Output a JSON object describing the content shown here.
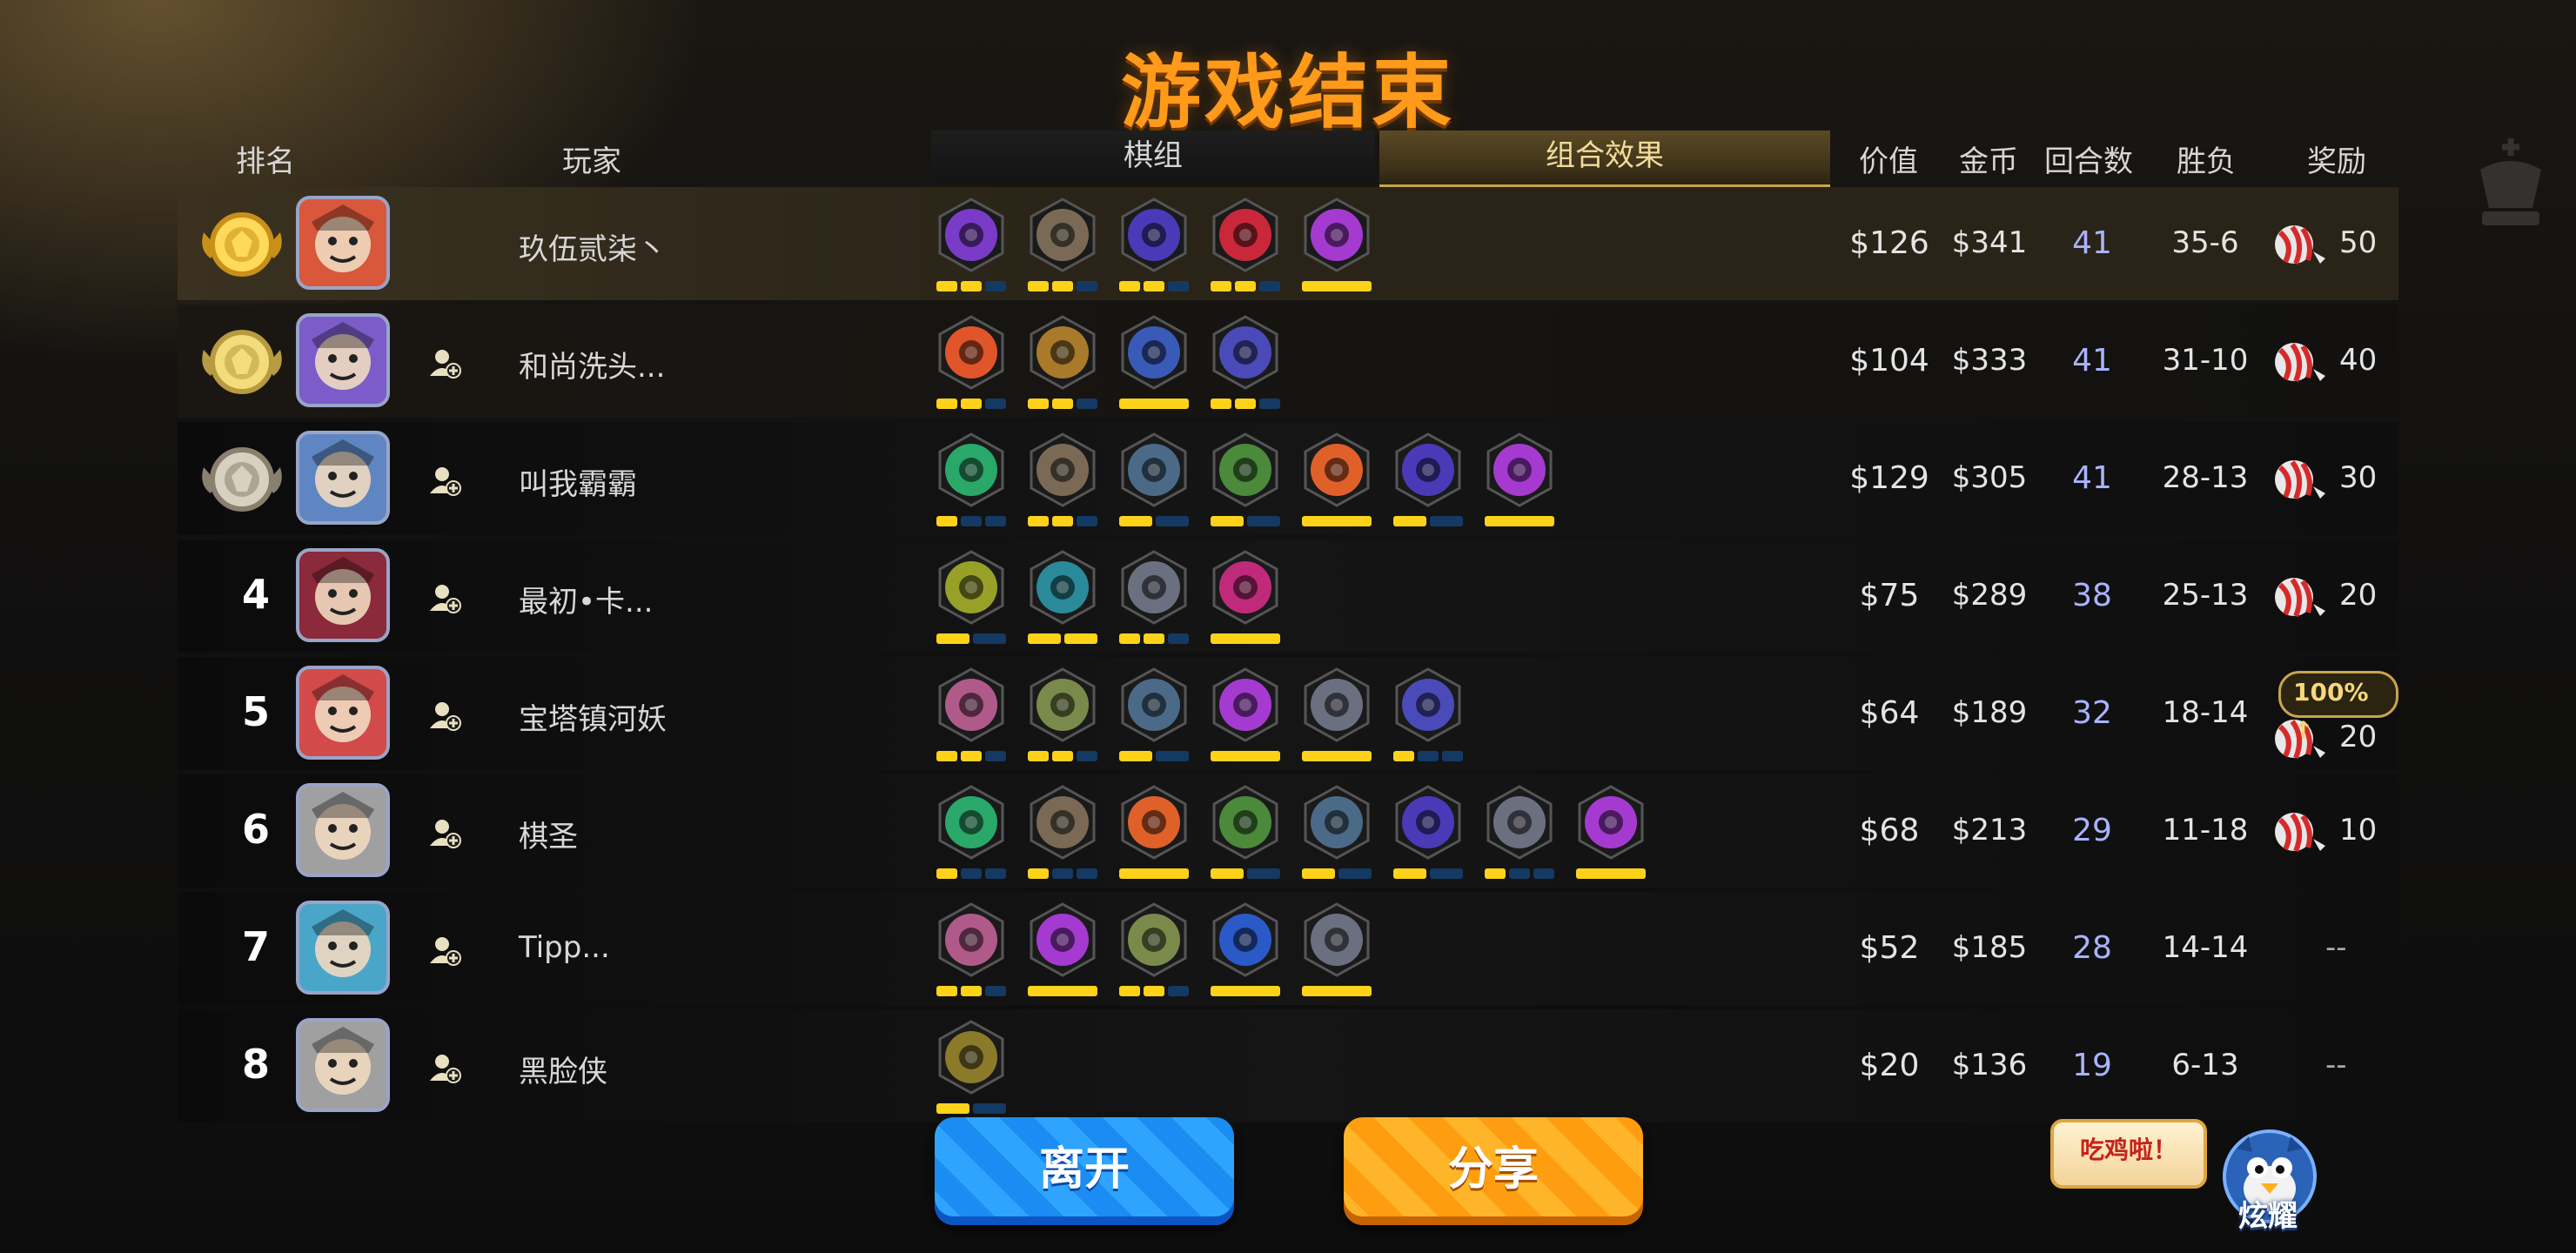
{
  "title": "游戏结束",
  "headers": {
    "rank": "排名",
    "player": "玩家",
    "lineup": "棋组",
    "synergy": "组合效果",
    "value": "价值",
    "gold": "金币",
    "rounds": "回合数",
    "winloss": "胜负",
    "reward": "奖励"
  },
  "colors": {
    "title": "#ff9a1a",
    "star_on": "#ffd21a",
    "star_off": "#143a63",
    "rounds": "#a9b3ff"
  },
  "rows": [
    {
      "rank": "",
      "medal": "gold-medal-icon",
      "name": "玖伍贰柒丶",
      "add_friend": false,
      "value": "$126",
      "gold": "$341",
      "rounds": "41",
      "winloss": "35-6",
      "reward": "50",
      "avatar_color": "#d9573a"
    },
    {
      "rank": "",
      "medal": "silver-gold-medal-icon",
      "name": "和尚洗头...",
      "add_friend": true,
      "value": "$104",
      "gold": "$333",
      "rounds": "41",
      "winloss": "31-10",
      "reward": "40",
      "avatar_color": "#7b5cc9"
    },
    {
      "rank": "",
      "medal": "bronze-medal-icon",
      "name": "叫我霸霸",
      "add_friend": true,
      "value": "$129",
      "gold": "$305",
      "rounds": "41",
      "winloss": "28-13",
      "reward": "30",
      "avatar_color": "#5f86c2"
    },
    {
      "rank": "4",
      "medal": "",
      "name": "最初•卡...",
      "add_friend": true,
      "value": "$75",
      "gold": "$289",
      "rounds": "38",
      "winloss": "25-13",
      "reward": "20",
      "avatar_color": "#8a2a3a"
    },
    {
      "rank": "5",
      "medal": "",
      "name": "宝塔镇河妖",
      "add_friend": true,
      "value": "$64",
      "gold": "$189",
      "rounds": "32",
      "winloss": "18-14",
      "reward": "20",
      "bonus": "100%",
      "avatar_color": "#d24a4a"
    },
    {
      "rank": "6",
      "medal": "",
      "name": "棋圣",
      "add_friend": true,
      "value": "$68",
      "gold": "$213",
      "rounds": "29",
      "winloss": "11-18",
      "reward": "10",
      "avatar_color": "#a0a0a0"
    },
    {
      "rank": "7",
      "medal": "",
      "name": "Tipp...",
      "add_friend": true,
      "value": "$52",
      "gold": "$185",
      "rounds": "28",
      "winloss": "14-14",
      "reward": "--",
      "avatar_color": "#4aa6c9"
    },
    {
      "rank": "8",
      "medal": "",
      "name": "黑脸侠",
      "add_friend": true,
      "value": "$20",
      "gold": "$136",
      "rounds": "19",
      "winloss": "6-13",
      "reward": "--",
      "avatar_color": "#a0a0a0"
    }
  ],
  "lineups": [
    [
      {
        "icon": "purple-demon-icon",
        "c": "#7a3cc8",
        "s": [
          1,
          1,
          0
        ]
      },
      {
        "icon": "axe-warrior-icon",
        "c": "#7a6a55",
        "s": [
          1,
          1,
          0
        ]
      },
      {
        "icon": "fish-skeleton-icon",
        "c": "#4a3ab8",
        "s": [
          1,
          1,
          0
        ]
      },
      {
        "icon": "red-arch-icon",
        "c": "#c8283a",
        "s": [
          1,
          1,
          0
        ]
      },
      {
        "icon": "purple-skull-icon",
        "c": "#a53ad0",
        "s": [
          1
        ]
      }
    ],
    [
      {
        "icon": "orange-beast-icon",
        "c": "#e0552a",
        "s": [
          1,
          1,
          0
        ]
      },
      {
        "icon": "gear-icon",
        "c": "#a87a2a",
        "s": [
          1,
          1,
          0
        ]
      },
      {
        "icon": "wizard-hat-icon",
        "c": "#3a5ab8",
        "s": [
          1
        ]
      },
      {
        "icon": "spellbook-icon",
        "c": "#4a4ab8",
        "s": [
          1,
          1,
          0
        ]
      }
    ],
    [
      {
        "icon": "paw-icon",
        "c": "#2aa86a",
        "s": [
          1,
          0,
          0
        ]
      },
      {
        "icon": "axe-warrior-icon",
        "c": "#7a6a55",
        "s": [
          1,
          1,
          0
        ]
      },
      {
        "icon": "swirl-icon",
        "c": "#4a6a88",
        "s": [
          1,
          0
        ]
      },
      {
        "icon": "bow-icon",
        "c": "#4a8a3a",
        "s": [
          1,
          0
        ]
      },
      {
        "icon": "horned-helmet-icon",
        "c": "#e0602a",
        "s": [
          1
        ]
      },
      {
        "icon": "fish-skeleton-icon",
        "c": "#4a3ab8",
        "s": [
          1,
          0
        ]
      },
      {
        "icon": "purple-skull-icon",
        "c": "#a53ad0",
        "s": [
          1
        ]
      }
    ],
    [
      {
        "icon": "ore-icon",
        "c": "#98a028",
        "s": [
          1,
          0
        ]
      },
      {
        "icon": "question-icon",
        "c": "#2a8a9a",
        "s": [
          1,
          1
        ]
      },
      {
        "icon": "knight-helm-icon",
        "c": "#6a7080",
        "s": [
          1,
          1,
          0
        ]
      },
      {
        "icon": "pink-blade-icon",
        "c": "#c02a7a",
        "s": [
          1
        ]
      }
    ],
    [
      {
        "icon": "chess-knight-icon",
        "c": "#b05a8a",
        "s": [
          1,
          1,
          0
        ]
      },
      {
        "icon": "goblin-icon",
        "c": "#7a8a4a",
        "s": [
          1,
          1,
          0
        ]
      },
      {
        "icon": "swirl-icon",
        "c": "#4a6a88",
        "s": [
          1,
          0
        ]
      },
      {
        "icon": "purple-skull-icon",
        "c": "#a53ad0",
        "s": [
          1
        ]
      },
      {
        "icon": "cross-icon",
        "c": "#6a7080",
        "s": [
          1
        ]
      },
      {
        "icon": "spellbook-icon",
        "c": "#4a4ab8",
        "s": [
          1,
          0,
          0
        ]
      }
    ],
    [
      {
        "icon": "paw-icon",
        "c": "#2aa86a",
        "s": [
          1,
          0,
          0
        ]
      },
      {
        "icon": "axe-warrior-icon",
        "c": "#7a6a55",
        "s": [
          1,
          0,
          0
        ]
      },
      {
        "icon": "horned-helmet-icon",
        "c": "#e0602a",
        "s": [
          1
        ]
      },
      {
        "icon": "bow-icon",
        "c": "#4a8a3a",
        "s": [
          1,
          0
        ]
      },
      {
        "icon": "swirl-icon",
        "c": "#4a6a88",
        "s": [
          1,
          0
        ]
      },
      {
        "icon": "fish-skeleton-icon",
        "c": "#4a3ab8",
        "s": [
          1,
          0
        ]
      },
      {
        "icon": "knight-helm-icon",
        "c": "#6a7080",
        "s": [
          1,
          0,
          0
        ]
      },
      {
        "icon": "purple-skull-icon",
        "c": "#a53ad0",
        "s": [
          1
        ]
      }
    ],
    [
      {
        "icon": "chess-knight-icon",
        "c": "#b05a8a",
        "s": [
          1,
          1,
          0
        ]
      },
      {
        "icon": "purple-skull-icon",
        "c": "#a53ad0",
        "s": [
          1
        ]
      },
      {
        "icon": "goblin-icon",
        "c": "#7a8a4a",
        "s": [
          1,
          1,
          0
        ]
      },
      {
        "icon": "blue-blades-icon",
        "c": "#2a5ac8",
        "s": [
          1
        ]
      },
      {
        "icon": "cross-icon",
        "c": "#6a7080",
        "s": [
          1
        ]
      }
    ],
    [
      {
        "icon": "claw-icon",
        "c": "#8a7a2a",
        "s": [
          1,
          0
        ]
      }
    ]
  ],
  "buttons": {
    "leave": "离开",
    "share": "分享"
  },
  "bubble": "吃鸡啦！",
  "flaunt": "炫耀"
}
